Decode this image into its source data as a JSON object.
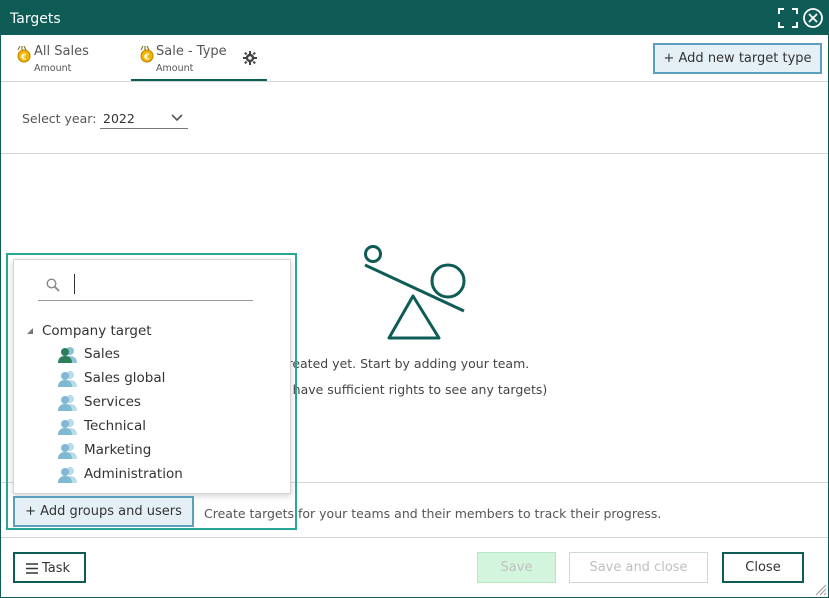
{
  "window": {
    "title": "Targets"
  },
  "titlebar_icons": [
    "expand-icon",
    "close-icon"
  ],
  "tabs": [
    {
      "label": "All Sales",
      "sublabel": "Amount",
      "icon": "coin-icon",
      "active": false
    },
    {
      "label": "Sale - Type",
      "sublabel": "Amount",
      "icon": "coin-icon",
      "active": true
    }
  ],
  "add_target_type_label": "Add new target type",
  "year_filter": {
    "label": "Select year:",
    "value": "2022"
  },
  "empty_state": {
    "line1": "argets created yet.  Start by adding your team.",
    "line2": "may not have sufficient rights to see any targets)"
  },
  "picker": {
    "search_value": "",
    "root_label": "Company target",
    "items": [
      {
        "label": "Sales",
        "icon": "group-icon-active"
      },
      {
        "label": "Sales global",
        "icon": "group-icon"
      },
      {
        "label": "Services",
        "icon": "group-icon"
      },
      {
        "label": "Technical",
        "icon": "group-icon"
      },
      {
        "label": "Marketing",
        "icon": "group-icon"
      },
      {
        "label": "Administration",
        "icon": "group-icon"
      }
    ]
  },
  "add_groups_label": "Add groups and users",
  "hint_text": "Create targets for your teams and their members to track their progress.",
  "footer": {
    "task_label": "Task",
    "save_label": "Save",
    "save_close_label": "Save and close",
    "close_label": "Close"
  },
  "colors": {
    "brand": "#0e5c55",
    "accent_border": "#5b9fbf",
    "highlight_outline": "#2aa597",
    "save_disabled_bg": "#d4f5dd"
  }
}
